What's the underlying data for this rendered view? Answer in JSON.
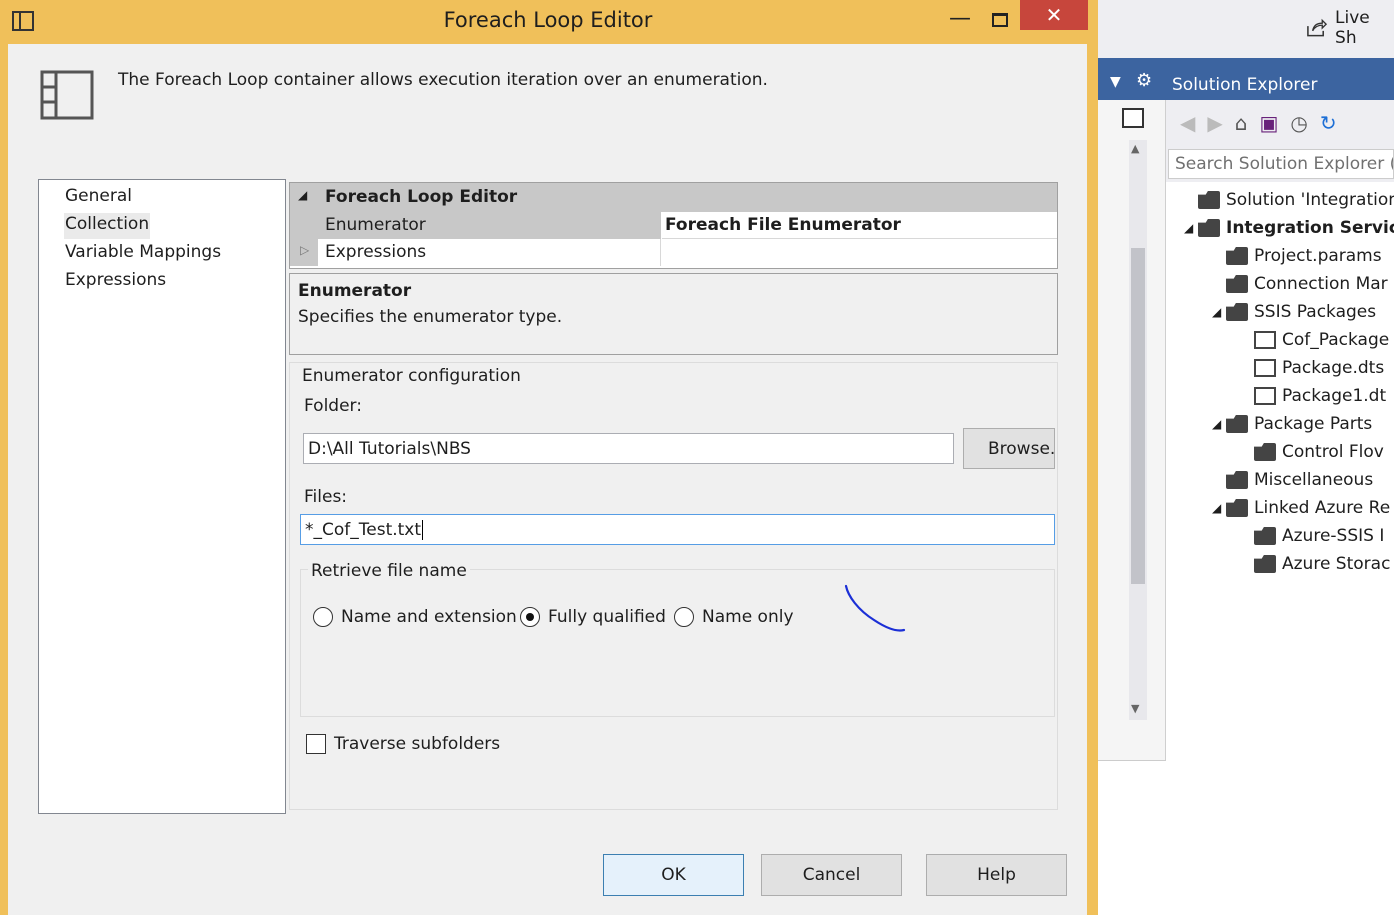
{
  "colors": {
    "title_bar": "#f0c05a",
    "close_button": "#c7463c",
    "vs_blue": "#3c64a0",
    "grid_category": "#c8c8c8",
    "ink": "#1b2fd6"
  },
  "dialog": {
    "title": "Foreach Loop Editor",
    "description": "The Foreach Loop container allows execution iteration over an enumeration.",
    "title_buttons": {
      "minimize": "—",
      "close": "✕"
    }
  },
  "nav": {
    "items": [
      "General",
      "Collection",
      "Variable Mappings",
      "Expressions"
    ],
    "selected": "Collection"
  },
  "grid": {
    "category": "Foreach Loop Editor",
    "rows": [
      {
        "name": "Enumerator",
        "value": "Foreach File Enumerator"
      },
      {
        "name": "Expressions",
        "value": ""
      }
    ]
  },
  "help_pane": {
    "title": "Enumerator",
    "text": "Specifies the enumerator type."
  },
  "config": {
    "group_title": "Enumerator configuration",
    "folder_label": "Folder:",
    "folder_value": "D:\\All Tutorials\\NBS",
    "browse_label": "Browse...",
    "files_label": "Files:",
    "files_value": "*_Cof_Test.txt",
    "retrieve_title": "Retrieve file name",
    "radios": [
      {
        "label": "Name and extension",
        "checked": false
      },
      {
        "label": "Fully qualified",
        "checked": true
      },
      {
        "label": "Name only",
        "checked": false
      }
    ],
    "traverse_label": "Traverse subfolders",
    "traverse_checked": false
  },
  "buttons": {
    "ok": "OK",
    "cancel": "Cancel",
    "help": "Help"
  },
  "vs": {
    "live_share": "Live Sh",
    "solution_explorer": "Solution Explorer",
    "search_placeholder": "Search Solution Explorer (Ct",
    "tree": [
      {
        "label": "Solution 'Integration S",
        "level": 0,
        "expander": "",
        "icon": "solution-icon",
        "bold": false
      },
      {
        "label": "Integration Servic",
        "level": 0,
        "expander": "◢",
        "icon": "project-icon",
        "bold": true
      },
      {
        "label": "Project.params",
        "level": 1,
        "expander": "",
        "icon": "params-icon",
        "bold": false
      },
      {
        "label": "Connection Mar",
        "level": 1,
        "expander": "",
        "icon": "folder-icon",
        "bold": false
      },
      {
        "label": "SSIS Packages",
        "level": 1,
        "expander": "◢",
        "icon": "folder-icon",
        "bold": false
      },
      {
        "label": "Cof_Package",
        "level": 2,
        "expander": "",
        "icon": "file-icon",
        "bold": false
      },
      {
        "label": "Package.dts",
        "level": 2,
        "expander": "",
        "icon": "file-icon",
        "bold": false
      },
      {
        "label": "Package1.dt",
        "level": 2,
        "expander": "",
        "icon": "file-icon",
        "bold": false
      },
      {
        "label": "Package Parts",
        "level": 1,
        "expander": "◢",
        "icon": "folder-icon",
        "bold": false
      },
      {
        "label": "Control Flov",
        "level": 2,
        "expander": "",
        "icon": "folder-icon",
        "bold": false
      },
      {
        "label": "Miscellaneous",
        "level": 1,
        "expander": "",
        "icon": "folder-icon",
        "bold": false
      },
      {
        "label": "Linked Azure Re",
        "level": 1,
        "expander": "◢",
        "icon": "folder-icon",
        "bold": false
      },
      {
        "label": "Azure-SSIS I",
        "level": 2,
        "expander": "",
        "icon": "folder-icon",
        "bold": false
      },
      {
        "label": "Azure Storac",
        "level": 2,
        "expander": "",
        "icon": "folder-icon",
        "bold": false
      }
    ]
  }
}
